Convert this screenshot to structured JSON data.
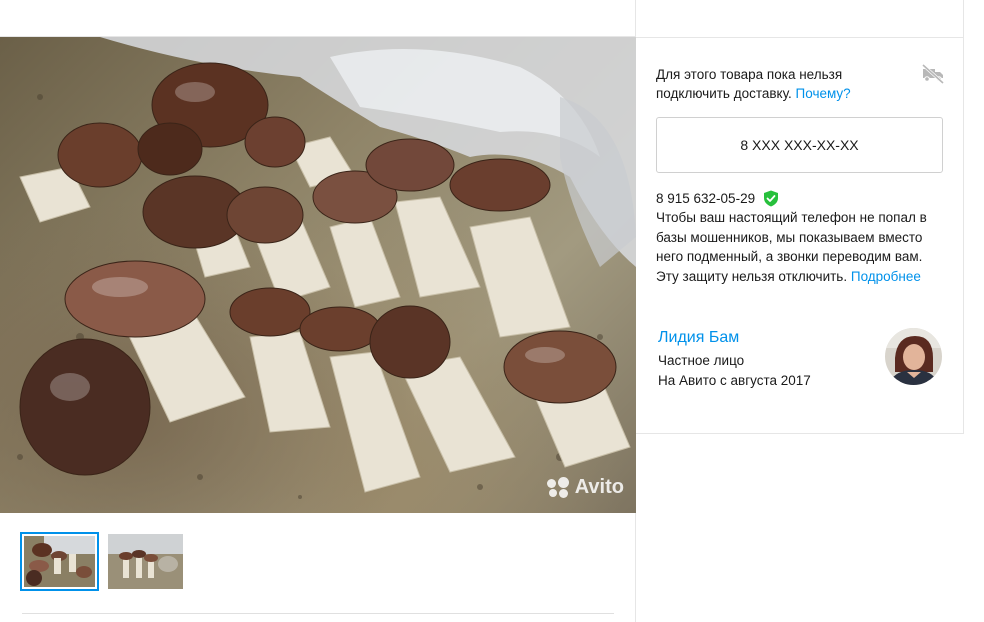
{
  "photo": {
    "watermark": "Avito",
    "description_icon": "mushrooms-photo"
  },
  "thumbnails": [
    {
      "name": "thumbnail-1",
      "active": true
    },
    {
      "name": "thumbnail-2",
      "active": false
    }
  ],
  "delivery": {
    "text": "Для этого товара пока нельзя подключить доставку.",
    "link": "Почему?",
    "icon": "no-delivery-icon"
  },
  "phone": {
    "button_label": "8 XXX XXX-XX-XX",
    "real_number": "8 915 632-05-29",
    "verified_icon": "shield-check-icon",
    "protection_text": "Чтобы ваш настоящий телефон не попал в базы мошенников, мы показываем вместо него подменный, а звонки переводим вам. Эту защиту нельзя отключить.",
    "protection_link": "Подробнее"
  },
  "seller": {
    "name": "Лидия Бам",
    "type": "Частное лицо",
    "since": "На Авито с августа 2017"
  },
  "colors": {
    "link": "#0091ea",
    "verified": "#27c03c",
    "border": "#e6e6e6"
  }
}
